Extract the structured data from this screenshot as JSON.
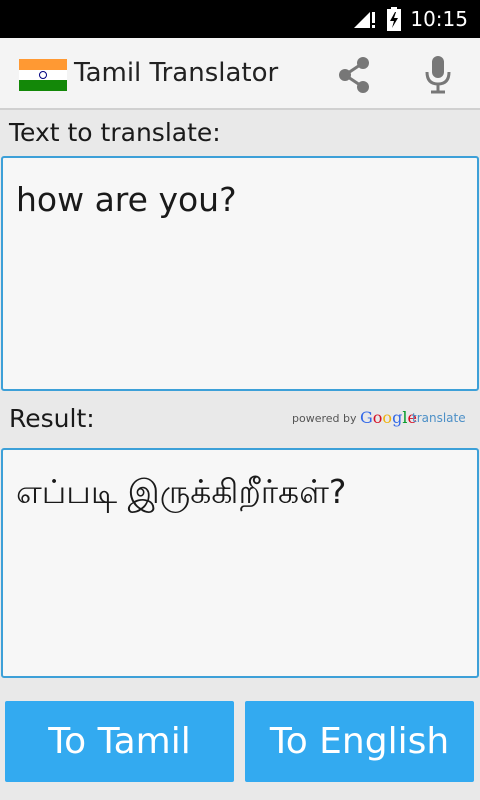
{
  "status_bar": {
    "time": "10:15",
    "icons": [
      "signal-icon",
      "battery-charging-icon"
    ]
  },
  "action_bar": {
    "title": "Tamil Translator",
    "icons": [
      "india-flag-icon",
      "share-icon",
      "microphone-icon"
    ]
  },
  "source": {
    "label": "Text to translate:",
    "text": "how are you?"
  },
  "result": {
    "label": "Result:",
    "text": "எப்படி இருக்கிறீர்கள்?"
  },
  "attribution": {
    "powered_by": "powered by",
    "brand_letters": [
      "G",
      "o",
      "o",
      "g",
      "l",
      "e"
    ],
    "brand_colors": [
      "#3369e8",
      "#d50f25",
      "#eeb211",
      "#3369e8",
      "#009925",
      "#d50f25"
    ],
    "suffix": "translate"
  },
  "buttons": {
    "to_tamil": "To Tamil",
    "to_english": "To English"
  },
  "colors": {
    "accent": "#33aaf0",
    "border": "#3da0d8"
  }
}
